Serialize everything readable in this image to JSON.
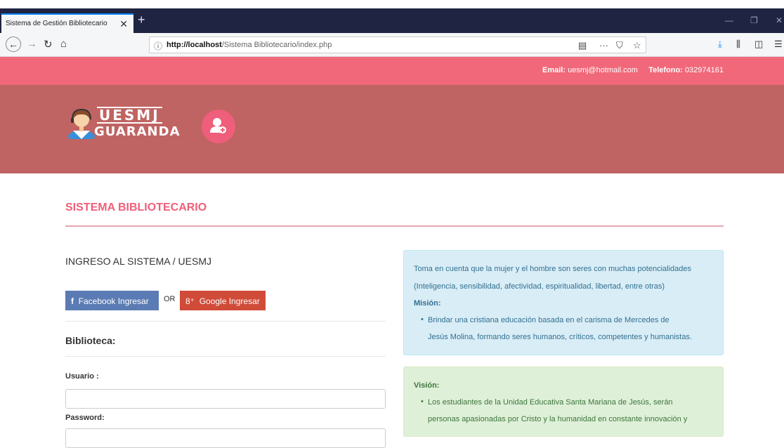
{
  "browser": {
    "tab_title": "Sistema de Gestión Bibliotecario",
    "tab_close": "✕",
    "new_tab": "+",
    "url_host": "http://localhost",
    "url_path": "/Sistema Bibliotecario/index.php",
    "menu_dots": "···"
  },
  "site": {
    "email_label": "Email:",
    "email_value": "uesmj@hotmail.com",
    "phone_label": "Telefono:",
    "phone_value": "032974161",
    "logo_top": "UESMJ",
    "logo_bottom": "GUARANDA"
  },
  "main": {
    "section_title": "SISTEMA BIBLIOTECARIO",
    "login_heading": "INGRESO AL SISTEMA / UESMJ",
    "facebook_button": "Facebook Ingresar",
    "or_text": "OR",
    "google_button": "Google Ingresar",
    "library_heading": "Biblioteca:",
    "user_label": "Usuario :",
    "password_label": "Password:"
  },
  "info": {
    "intro_line1": "Toma en cuenta que la mujer y el hombre son seres con muchas potencialidades",
    "intro_line2": "(Inteligencia, sensibilidad, afectividad, espiritualidad, libertad, entre otras)",
    "mission_label": "Misión:",
    "mission_line1": "Brindar una cristiana educación basada en el carisma de Mercedes de",
    "mission_line2": "Jesús Molina, formando seres humanos, críticos, competentes y humanistas.",
    "vision_label": "Visión:",
    "vision_line1": "Los estudiantes de la Unidad Educativa Santa Mariana de Jesús, serán",
    "vision_line2": "personas apasionadas por Cristo y la humanidad en constante innovación y"
  },
  "colors": {
    "topbar": "#f0687a",
    "header": "#bf6462",
    "accent": "#ef5e7a",
    "facebook": "#5b7bb4",
    "google": "#d04b38"
  }
}
